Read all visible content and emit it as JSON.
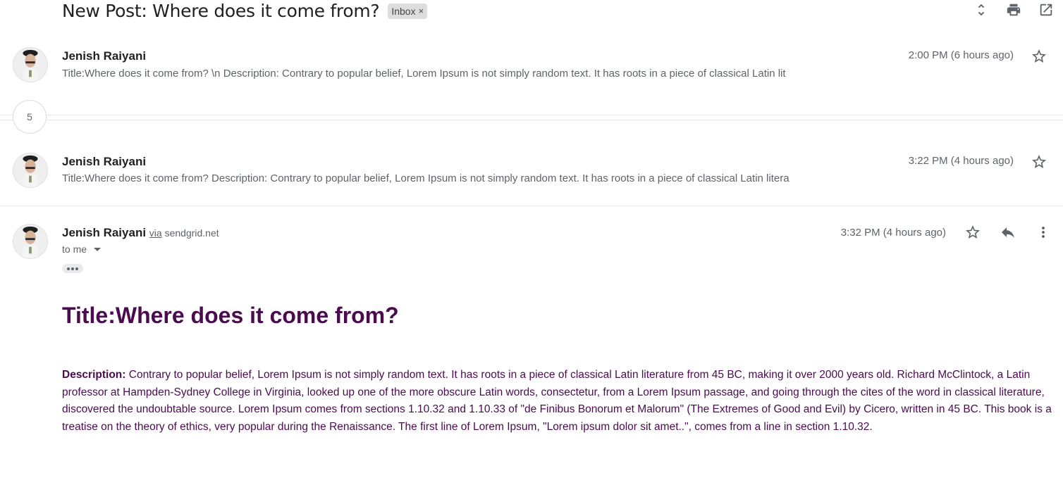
{
  "thread": {
    "subject": "New Post: Where does it come from?",
    "label": "Inbox",
    "label_remove": "×",
    "collapsed_count": "5"
  },
  "messages": [
    {
      "sender": "Jenish Raiyani",
      "snippet": "Title:Where does it come from? \\n Description: Contrary to popular belief, Lorem Ipsum is not simply random text. It has roots in a piece of classical Latin lit",
      "time": "2:00 PM (6 hours ago)"
    },
    {
      "sender": "Jenish Raiyani",
      "snippet": "Title:Where does it come from? Description: Contrary to popular belief, Lorem Ipsum is not simply random text. It has roots in a piece of classical Latin litera",
      "time": "3:22 PM (4 hours ago)"
    }
  ],
  "open_message": {
    "sender": "Jenish Raiyani",
    "via_label": "via",
    "via_domain": "sendgrid.net",
    "to": "to me",
    "time": "3:32 PM (4 hours ago)",
    "title": "Title:Where does it come from?",
    "description_label": "Description:",
    "description": "Contrary to popular belief, Lorem Ipsum is not simply random text. It has roots in a piece of classical Latin literature from 45 BC, making it over 2000 years old. Richard McClintock, a Latin professor at Hampden-Sydney College in Virginia, looked up one of the more obscure Latin words, consectetur, from a Lorem Ipsum passage, and going through the cites of the word in classical literature, discovered the undoubtable source. Lorem Ipsum comes from sections 1.10.32 and 1.10.33 of \"de Finibus Bonorum et Malorum\" (The Extremes of Good and Evil) by Cicero, written in 45 BC. This book is a treatise on the theory of ethics, very popular during the Renaissance. The first line of Lorem Ipsum, \"Lorem ipsum dolor sit amet..\", comes from a line in section 1.10.32."
  },
  "icons": {
    "header": [
      "expand-collapse-icon",
      "print-icon",
      "open-in-new-window-icon"
    ],
    "message": [
      "star-icon",
      "reply-icon",
      "more-options-icon"
    ]
  },
  "colors": {
    "body_text": "#4a0b4f",
    "label_chip_bg": "#dddddd",
    "secondary_text": "#5f6368"
  }
}
